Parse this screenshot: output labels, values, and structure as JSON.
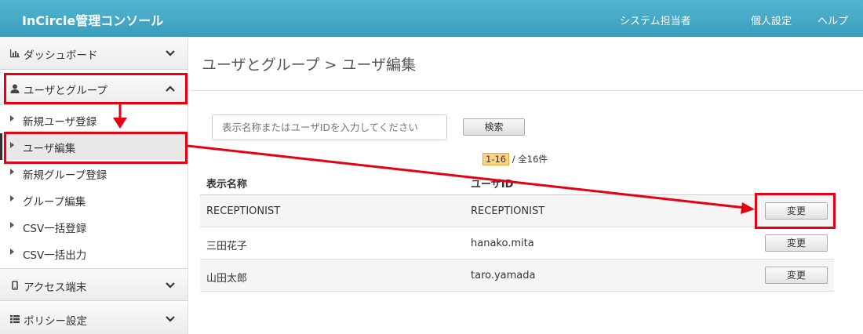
{
  "header": {
    "title": "InCircle管理コンソール",
    "nav": [
      "システム担当者",
      "個人設定",
      "ヘルプ"
    ]
  },
  "sidebar": {
    "dashboard": {
      "label": "ダッシュボード",
      "icon": "bar-chart-icon"
    },
    "users_groups": {
      "label": "ユーザとグループ",
      "icon": "user-icon"
    },
    "items": [
      {
        "label": "新規ユーザ登録"
      },
      {
        "label": "ユーザ編集"
      },
      {
        "label": "新規グループ登録"
      },
      {
        "label": "グループ編集"
      },
      {
        "label": "CSV一括登録"
      },
      {
        "label": "CSV一括出力"
      }
    ],
    "access_devices": {
      "label": "アクセス端末",
      "icon": "mobile-icon"
    },
    "policy": {
      "label": "ポリシー設定",
      "icon": "list-icon"
    }
  },
  "main": {
    "page_title": "ユーザとグループ > ユーザ編集",
    "search": {
      "placeholder": "表示名称またはユーザIDを入力してください",
      "button": "検索"
    },
    "pager": {
      "range": "1-16",
      "separator": "/",
      "total": "全16件"
    },
    "table": {
      "headers": [
        "表示名称",
        "ユーザID"
      ],
      "rows": [
        {
          "name": "RECEPTIONIST",
          "id": "RECEPTIONIST",
          "action": "変更"
        },
        {
          "name": "三田花子",
          "id": "hanako.mita",
          "action": "変更"
        },
        {
          "name": "山田太郎",
          "id": "taro.yamada",
          "action": "変更"
        }
      ]
    }
  },
  "colors": {
    "header": "#3a9cbd",
    "annotation": "#e60012",
    "pager_badge": "#fbd384"
  }
}
